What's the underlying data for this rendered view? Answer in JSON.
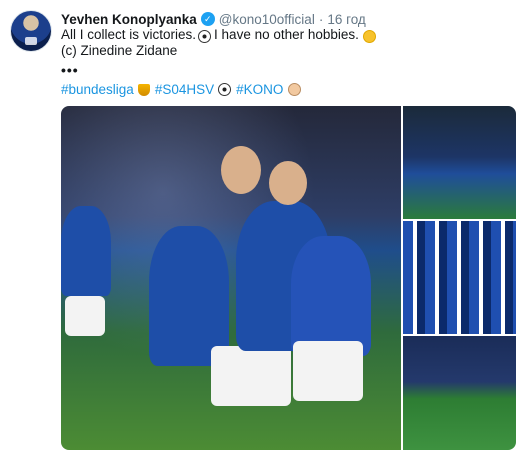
{
  "tweet": {
    "author_name": "Yevhen Konoplyanka",
    "handle": "@kono10official",
    "separator": "·",
    "time": "16 год",
    "text_line1_a": "All I collect is victories.",
    "text_line1_b": "I have no other hobbies.",
    "text_line2": "(c) Zinedine Zidane",
    "more": "•••",
    "hashtags": [
      "#bundesliga",
      "#S04HSV",
      "#KONO"
    ],
    "icons": [
      "soccer-ball-icon",
      "winking-face-icon",
      "trophy-icon",
      "verified-badge-icon",
      "man-face-icon"
    ]
  },
  "colors": {
    "text": "#14171a",
    "muted": "#657786",
    "link": "#1b95e0",
    "verified": "#1da1f2"
  }
}
